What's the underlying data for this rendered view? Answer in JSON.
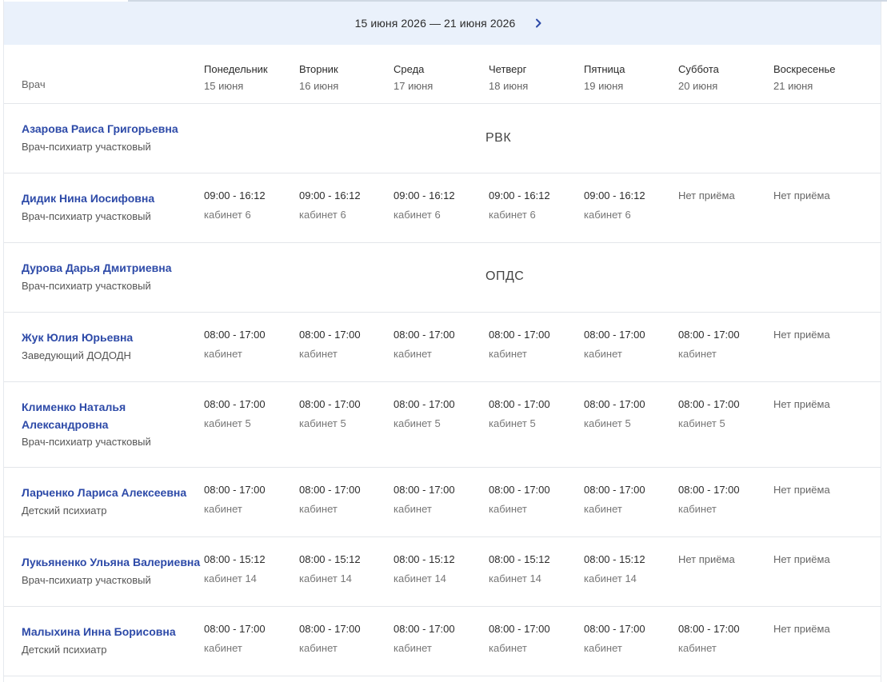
{
  "week": {
    "range": "15 июня 2026 — 21 июня 2026",
    "next_icon": "chevron-right-icon"
  },
  "header": {
    "doctor_col": "Врач",
    "days": [
      {
        "name": "Понедельник",
        "date": "15 июня"
      },
      {
        "name": "Вторник",
        "date": "16 июня"
      },
      {
        "name": "Среда",
        "date": "17 июня"
      },
      {
        "name": "Четверг",
        "date": "18 июня"
      },
      {
        "name": "Пятница",
        "date": "19 июня"
      },
      {
        "name": "Суббота",
        "date": "20 июня"
      },
      {
        "name": "Воскресенье",
        "date": "21 июня"
      }
    ]
  },
  "colors": {
    "link": "#2d4aa8",
    "week_bar": "#eaf1fb"
  },
  "doctors": [
    {
      "name": "Азарова Раиса Григорьевна",
      "role": "Врач-психиатр участковый",
      "note": "РВК"
    },
    {
      "name": "Дидик Нина Иосифовна",
      "role": "Врач-психиатр участковый",
      "slots": [
        {
          "time": "09:00 - 16:12",
          "room": "кабинет 6"
        },
        {
          "time": "09:00 - 16:12",
          "room": "кабинет 6"
        },
        {
          "time": "09:00 - 16:12",
          "room": "кабинет 6"
        },
        {
          "time": "09:00 - 16:12",
          "room": "кабинет 6"
        },
        {
          "time": "09:00 - 16:12",
          "room": "кабинет 6"
        },
        {
          "none": "Нет приёма"
        },
        {
          "none": "Нет приёма"
        }
      ]
    },
    {
      "name": "Дурова Дарья Дмитриевна",
      "role": "Врач-психиатр участковый",
      "note": "ОПДС"
    },
    {
      "name": "Жук Юлия Юрьевна",
      "role": "Заведующий ДОДОДН",
      "slots": [
        {
          "time": "08:00 - 17:00",
          "room": "кабинет"
        },
        {
          "time": "08:00 - 17:00",
          "room": "кабинет"
        },
        {
          "time": "08:00 - 17:00",
          "room": "кабинет"
        },
        {
          "time": "08:00 - 17:00",
          "room": "кабинет"
        },
        {
          "time": "08:00 - 17:00",
          "room": "кабинет"
        },
        {
          "time": "08:00 - 17:00",
          "room": "кабинет"
        },
        {
          "none": "Нет приёма"
        }
      ]
    },
    {
      "name": "Клименко Наталья Александровна",
      "role": "Врач-психиатр участковый",
      "slots": [
        {
          "time": "08:00 - 17:00",
          "room": "кабинет 5"
        },
        {
          "time": "08:00 - 17:00",
          "room": "кабинет 5"
        },
        {
          "time": "08:00 - 17:00",
          "room": "кабинет 5"
        },
        {
          "time": "08:00 - 17:00",
          "room": "кабинет 5"
        },
        {
          "time": "08:00 - 17:00",
          "room": "кабинет 5"
        },
        {
          "time": "08:00 - 17:00",
          "room": "кабинет 5"
        },
        {
          "none": "Нет приёма"
        }
      ]
    },
    {
      "name": "Ларченко Лариса Алексеевна",
      "role": "Детский психиатр",
      "slots": [
        {
          "time": "08:00 - 17:00",
          "room": "кабинет"
        },
        {
          "time": "08:00 - 17:00",
          "room": "кабинет"
        },
        {
          "time": "08:00 - 17:00",
          "room": "кабинет"
        },
        {
          "time": "08:00 - 17:00",
          "room": "кабинет"
        },
        {
          "time": "08:00 - 17:00",
          "room": "кабинет"
        },
        {
          "time": "08:00 - 17:00",
          "room": "кабинет"
        },
        {
          "none": "Нет приёма"
        }
      ]
    },
    {
      "name": "Лукьяненко Ульяна Валериевна",
      "role": "Врач-психиатр участковый",
      "slots": [
        {
          "time": "08:00 - 15:12",
          "room": "кабинет 14"
        },
        {
          "time": "08:00 - 15:12",
          "room": "кабинет 14"
        },
        {
          "time": "08:00 - 15:12",
          "room": "кабинет 14"
        },
        {
          "time": "08:00 - 15:12",
          "room": "кабинет 14"
        },
        {
          "time": "08:00 - 15:12",
          "room": "кабинет 14"
        },
        {
          "none": "Нет приёма"
        },
        {
          "none": "Нет приёма"
        }
      ]
    },
    {
      "name": "Малыхина Инна Борисовна",
      "role": "Детский психиатр",
      "slots": [
        {
          "time": "08:00 - 17:00",
          "room": "кабинет"
        },
        {
          "time": "08:00 - 17:00",
          "room": "кабинет"
        },
        {
          "time": "08:00 - 17:00",
          "room": "кабинет"
        },
        {
          "time": "08:00 - 17:00",
          "room": "кабинет"
        },
        {
          "time": "08:00 - 17:00",
          "room": "кабинет"
        },
        {
          "time": "08:00 - 17:00",
          "room": "кабинет"
        },
        {
          "none": "Нет приёма"
        }
      ]
    }
  ]
}
